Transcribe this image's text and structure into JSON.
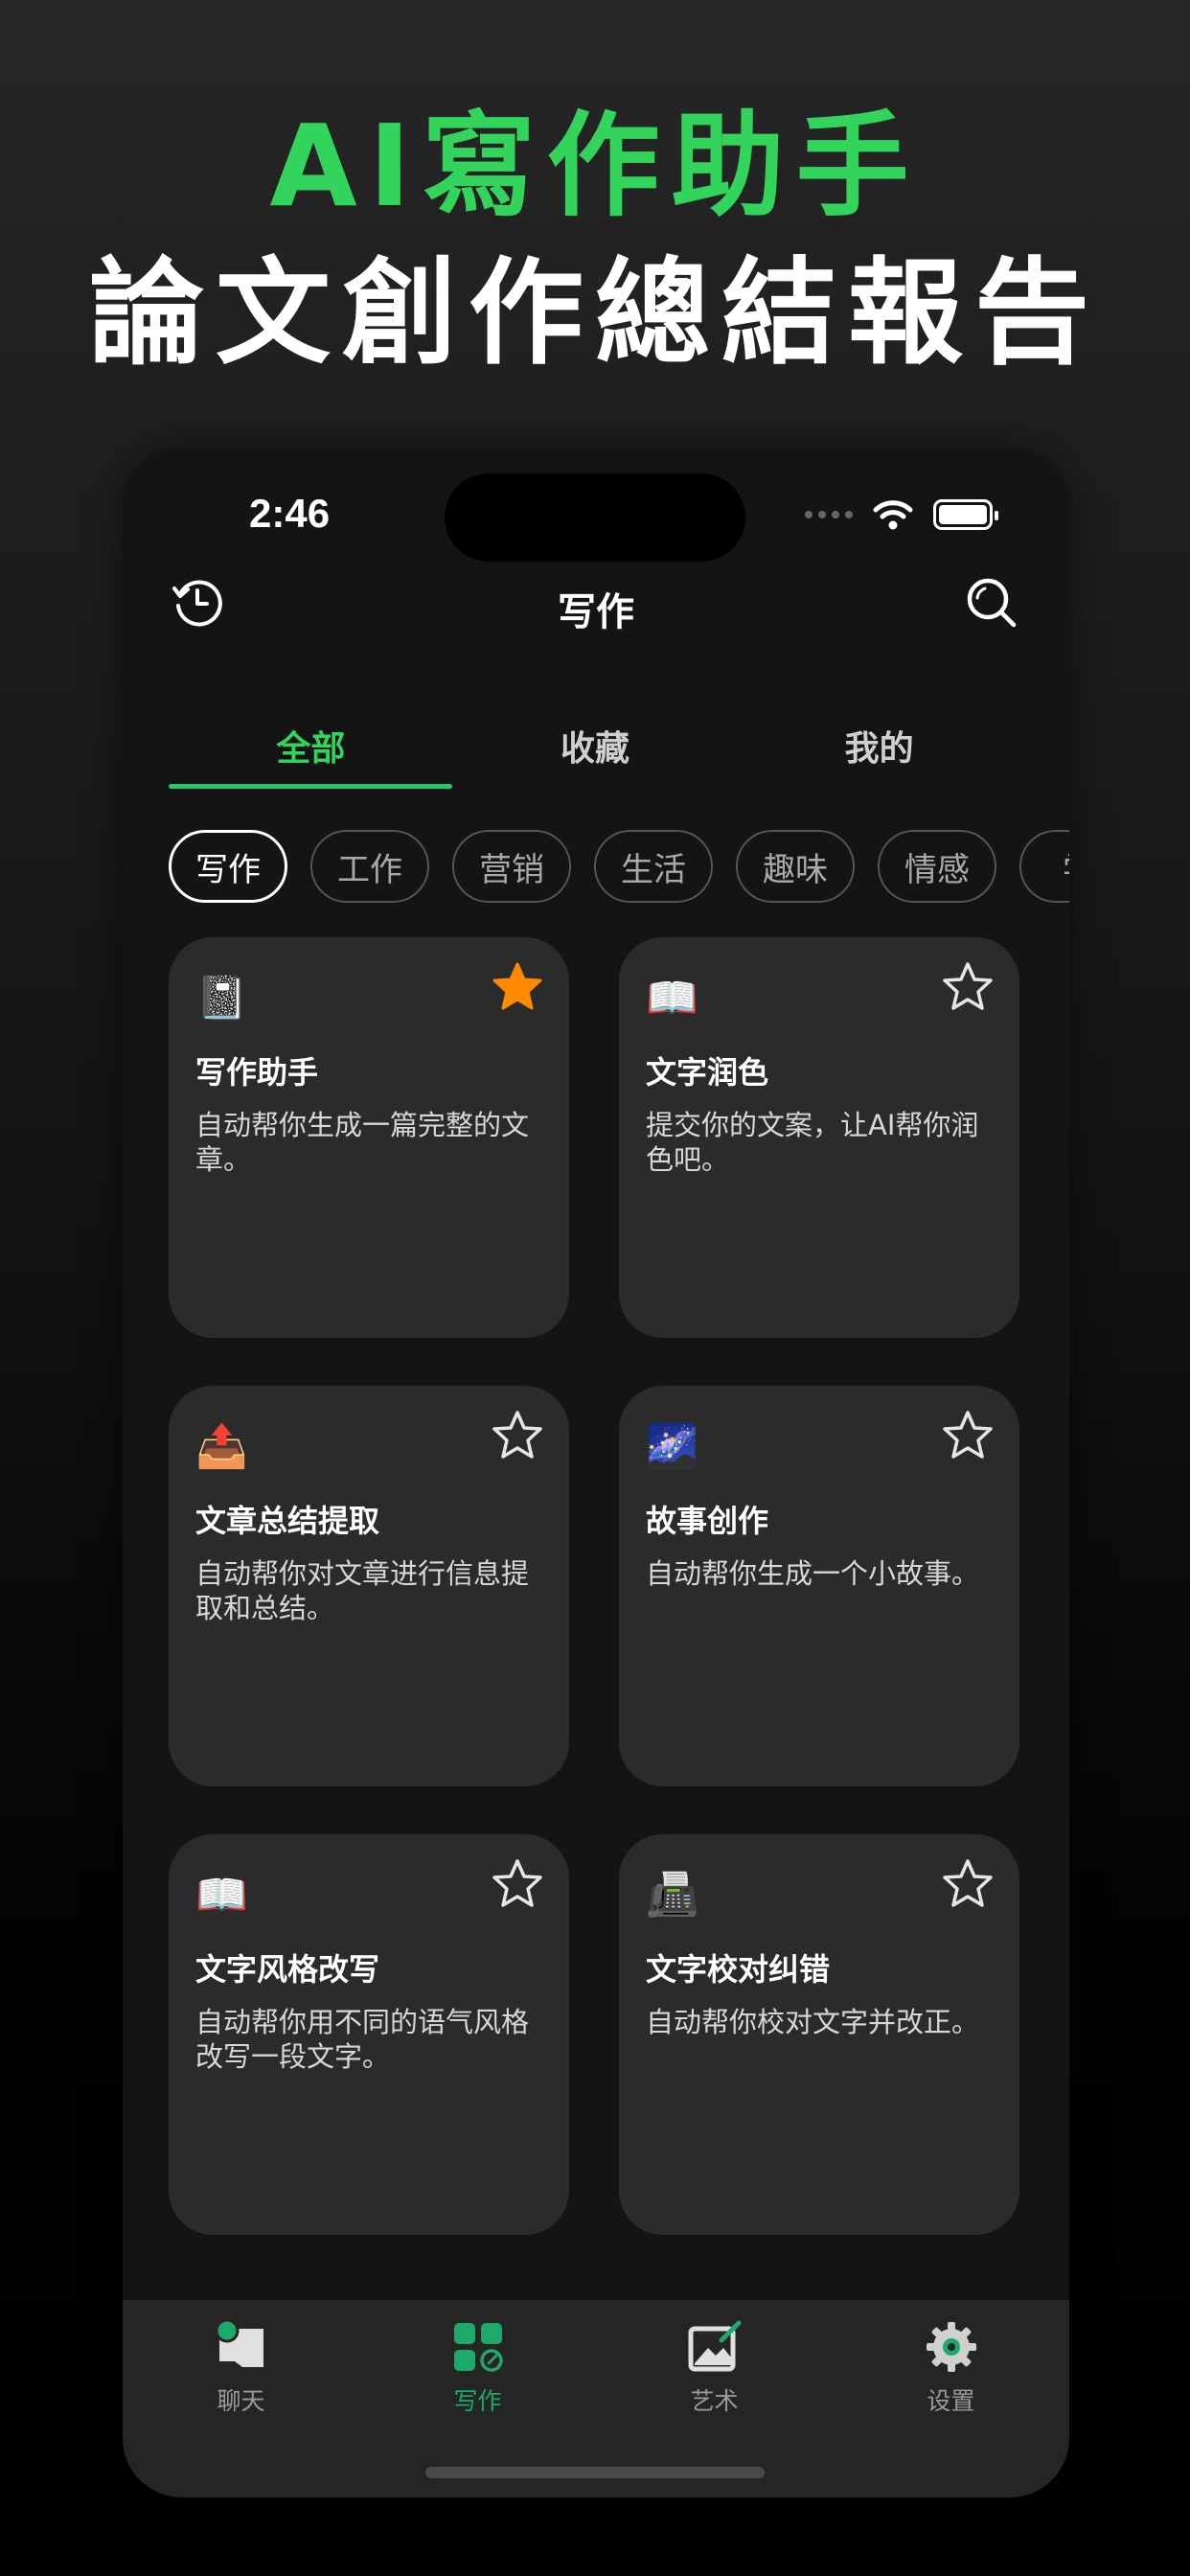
{
  "headline": {
    "line1": "AI寫作助手",
    "line2": "論文創作總結報告"
  },
  "status_bar": {
    "time": "2:46"
  },
  "nav": {
    "title": "写作",
    "left_icon": "history-icon",
    "right_icon": "search-icon"
  },
  "tabs": [
    {
      "label": "全部",
      "active": true
    },
    {
      "label": "收藏",
      "active": false
    },
    {
      "label": "我的",
      "active": false
    }
  ],
  "chips": [
    {
      "label": "写作",
      "active": true
    },
    {
      "label": "工作"
    },
    {
      "label": "营销"
    },
    {
      "label": "生活"
    },
    {
      "label": "趣味"
    },
    {
      "label": "情感"
    },
    {
      "label": "学"
    }
  ],
  "cards": [
    {
      "emoji": "📓",
      "title": "写作助手",
      "desc": "自动帮你生成一篇完整的文章。",
      "favorited": true
    },
    {
      "emoji": "📖",
      "title": "文字润色",
      "desc": "提交你的文案，让AI帮你润色吧。",
      "favorited": false
    },
    {
      "emoji": "📤",
      "title": "文章总结提取",
      "desc": "自动帮你对文章进行信息提取和总结。",
      "favorited": false
    },
    {
      "emoji": "🌌",
      "title": "故事创作",
      "desc": "自动帮你生成一个小故事。",
      "favorited": false
    },
    {
      "emoji": "📖",
      "title": "文字风格改写",
      "desc": "自动帮你用不同的语气风格改写一段文字。",
      "favorited": false
    },
    {
      "emoji": "📠",
      "title": "文字校对纠错",
      "desc": "自动帮你校对文字并改正。",
      "favorited": false
    }
  ],
  "tabbar": [
    {
      "label": "聊天",
      "icon": "chat-icon",
      "active": false
    },
    {
      "label": "写作",
      "icon": "writing-grid-icon",
      "active": true
    },
    {
      "label": "艺术",
      "icon": "art-icon",
      "active": false
    },
    {
      "label": "设置",
      "icon": "gear-icon",
      "active": false
    }
  ],
  "colors": {
    "accent": "#33d45c",
    "tab_accent": "#1ea86a",
    "favorite": "#ff8a00",
    "card": "#2b2b2b"
  }
}
